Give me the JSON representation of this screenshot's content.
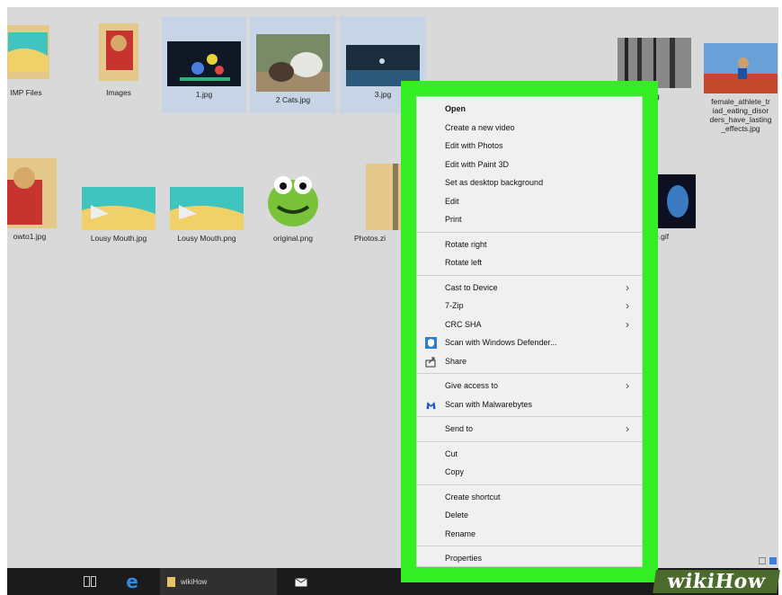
{
  "files_row1": [
    {
      "label": "IMP Files",
      "selected": false
    },
    {
      "label": "Images",
      "selected": false
    },
    {
      "label": "1.jpg",
      "selected": true
    },
    {
      "label": "2 Cats.jpg",
      "selected": true
    },
    {
      "label": "3.jpg",
      "selected": true
    },
    {
      "label": "",
      "selected": false
    },
    {
      "label": "",
      "selected": false
    },
    {
      "label": "jpg",
      "selected": false
    },
    {
      "label": "female_athlete_tr iad_eating_disor ders_have_lasting _effects.jpg",
      "selected": false
    }
  ],
  "files_row2": [
    {
      "label": "owto1.jpg"
    },
    {
      "label": "Lousy Mouth.jpg"
    },
    {
      "label": "Lousy Mouth.png"
    },
    {
      "label": "original.png"
    },
    {
      "label": "Photos.zi"
    },
    {
      "label": "e.gif"
    }
  ],
  "context_menu": {
    "items": [
      {
        "label": "Open",
        "bold": true,
        "arrow": false
      },
      {
        "label": "Create a new video"
      },
      {
        "label": "Edit with Photos"
      },
      {
        "label": "Edit with Paint 3D"
      },
      {
        "label": "Set as desktop background"
      },
      {
        "label": "Edit"
      },
      {
        "label": "Print"
      },
      {
        "sep": true
      },
      {
        "label": "Rotate right"
      },
      {
        "label": "Rotate left"
      },
      {
        "sep": true
      },
      {
        "label": "Cast to Device",
        "arrow": true
      },
      {
        "label": "7-Zip",
        "arrow": true
      },
      {
        "label": "CRC SHA",
        "arrow": true
      },
      {
        "label": "Scan with Windows Defender...",
        "icon": "defender-icon"
      },
      {
        "label": "Share",
        "icon": "share-icon"
      },
      {
        "sep": true
      },
      {
        "label": "Give access to",
        "arrow": true
      },
      {
        "label": "Scan with Malwarebytes",
        "icon": "malwarebytes-icon"
      },
      {
        "sep": true
      },
      {
        "label": "Send to",
        "arrow": true
      },
      {
        "sep": true
      },
      {
        "label": "Cut"
      },
      {
        "label": "Copy"
      },
      {
        "sep": true
      },
      {
        "label": "Create shortcut"
      },
      {
        "label": "Delete"
      },
      {
        "label": "Rename"
      },
      {
        "sep": true
      },
      {
        "label": "Properties"
      }
    ]
  },
  "taskbar": {
    "window_label": "wikiHow",
    "icons": [
      "task-view-icon",
      "edge-icon",
      "file-explorer-icon",
      "mail-icon"
    ]
  },
  "watermark": "wikiHow",
  "colors": {
    "highlight": "#33ee22",
    "selection": "#c6d4e6",
    "taskbar": "#1b1b1b"
  }
}
